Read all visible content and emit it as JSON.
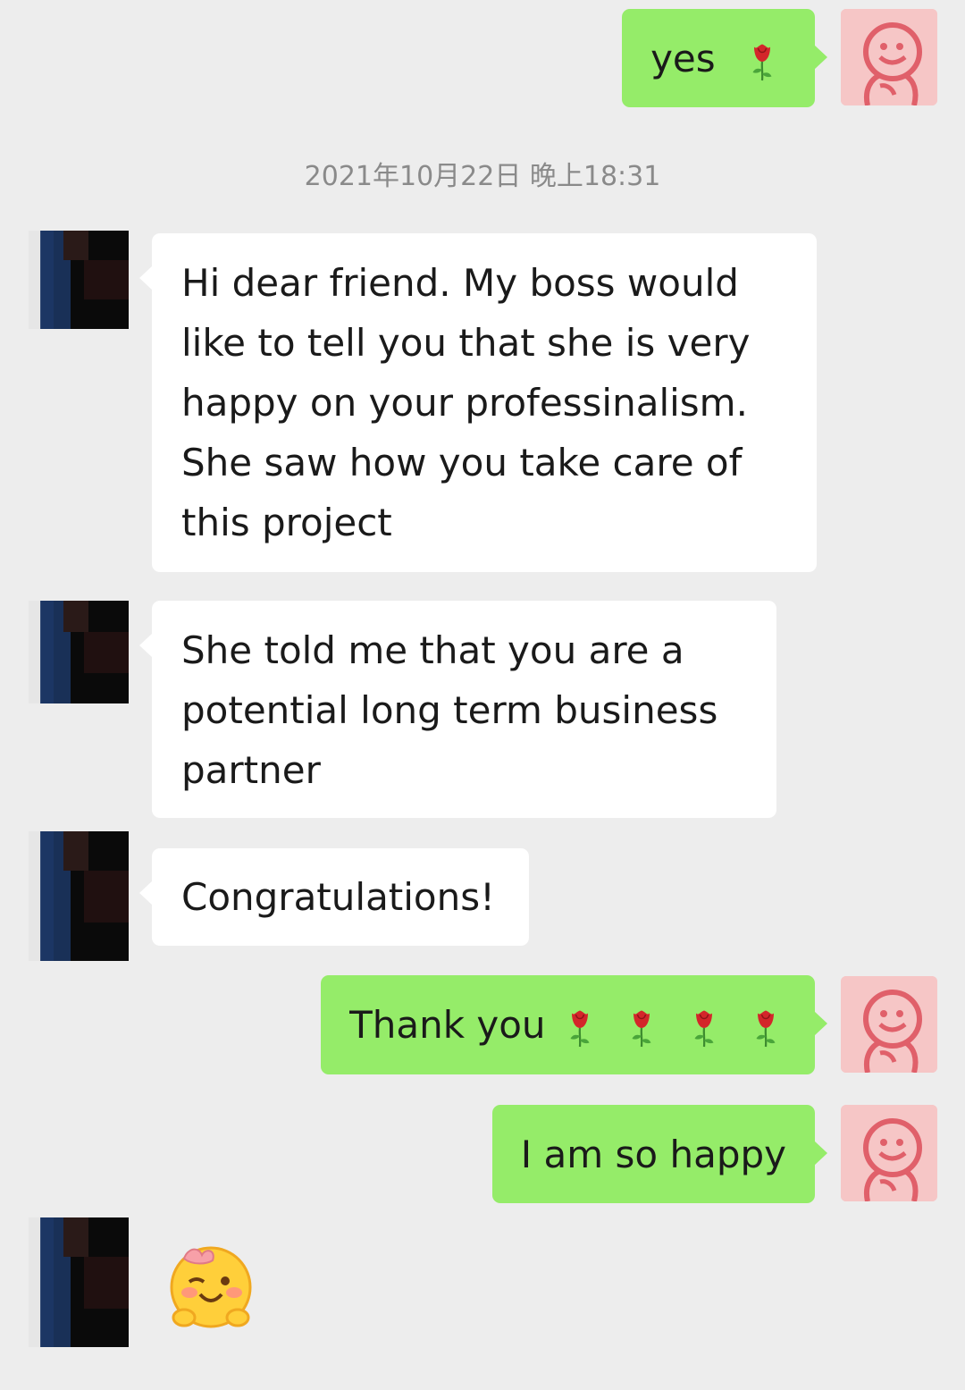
{
  "timestamp": "2021年10月22日 晚上18:31",
  "messages": [
    {
      "id": 1,
      "sender": "me",
      "text": "yes",
      "emoji_count": 1,
      "emoji": "rose-icon"
    },
    {
      "id": 2,
      "sender": "other",
      "text": "Hi dear friend. My boss would like to tell you that she is very happy on your professinalism. She saw how you take care of this project"
    },
    {
      "id": 3,
      "sender": "other",
      "text": "She told me that you are a potential long term business partner"
    },
    {
      "id": 4,
      "sender": "other",
      "text": "Congratulations!"
    },
    {
      "id": 5,
      "sender": "me",
      "text": "Thank you",
      "emoji_count": 4,
      "emoji": "rose-icon"
    },
    {
      "id": 6,
      "sender": "me",
      "text": "I am so happy"
    },
    {
      "id": 7,
      "sender": "other",
      "sticker": "blushing-winking-emoji-icon"
    }
  ],
  "colors": {
    "background": "#ededed",
    "out_bubble": "#95ec69",
    "in_bubble": "#ffffff",
    "my_avatar_bg": "#f6c6c6",
    "my_avatar_stroke": "#e0606a"
  }
}
